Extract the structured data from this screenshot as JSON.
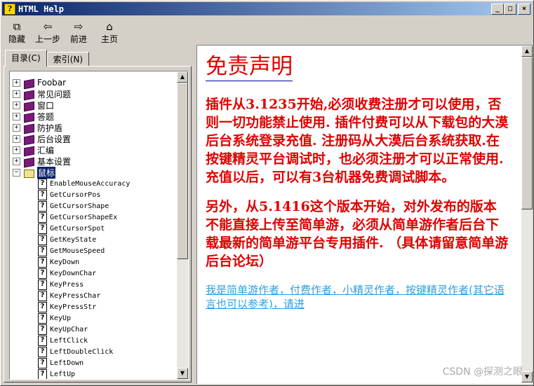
{
  "window": {
    "title": "HTML Help",
    "min": "_",
    "max": "□",
    "close": "×"
  },
  "toolbar": [
    {
      "label": "隐藏",
      "icon": "hide-icon",
      "glyph": "⧉"
    },
    {
      "label": "上一步",
      "icon": "back-arrow-icon",
      "glyph": "⇦"
    },
    {
      "label": "前进",
      "icon": "forward-arrow-icon",
      "glyph": "⇨"
    },
    {
      "label": "主页",
      "icon": "home-icon",
      "glyph": "⌂"
    }
  ],
  "tabs": [
    {
      "label": "目录(C)"
    },
    {
      "label": "索引(N)"
    }
  ],
  "tree": {
    "books": [
      "Foobar",
      "常见问题",
      "窗口",
      "答题",
      "防护盾",
      "后台设置",
      "汇编",
      "基本设置"
    ],
    "open_book": "鼠标",
    "pages": [
      "EnableMouseAccuracy",
      "GetCursorPos",
      "GetCursorShape",
      "GetCursorShapeEx",
      "GetCursorSpot",
      "GetKeyState",
      "GetMouseSpeed",
      "KeyDown",
      "KeyDownChar",
      "KeyPress",
      "KeyPressChar",
      "KeyPressStr",
      "KeyUp",
      "KeyUpChar",
      "LeftClick",
      "LeftDoubleClick",
      "LeftDown",
      "LeftUp"
    ]
  },
  "article": {
    "title": "免责声明",
    "para1": "插件从3.1235开始,必须收费注册才可以使用，否则一切功能禁止使用. 插件付费可以从下载包的大漠后台系统登录充值. 注册码从大漠后台系统获取.在按键精灵平台调试时，也必须注册才可以正常使用. 充值以后，可以有3台机器免费调试脚本。",
    "para2": "另外，从5.1416这个版本开始，对外发布的版本不能直接上传至简单游，必须从简单游作者后台下载最新的简单游平台专用插件. （具体请留意简单游后台论坛）",
    "link": "我是简单游作者，付费作者，小精灵作者，按键精灵作者(其它语言也可以参考)，请进"
  },
  "watermark": "CSDN @探测之眼",
  "colors": {
    "title_bar": "#0a246a",
    "article_text": "#e00000",
    "link": "#2aa0e0",
    "selection": "#0a246a"
  }
}
